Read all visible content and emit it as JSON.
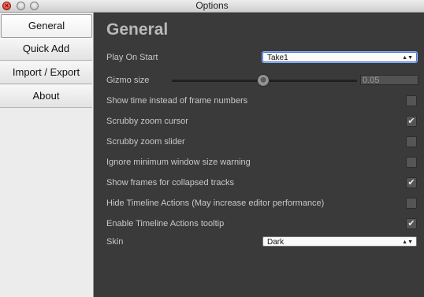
{
  "window": {
    "title": "Options"
  },
  "sidebar": {
    "items": [
      {
        "label": "General",
        "active": true
      },
      {
        "label": "Quick Add",
        "active": false
      },
      {
        "label": "Import / Export",
        "active": false
      },
      {
        "label": "About",
        "active": false
      }
    ]
  },
  "main": {
    "heading": "General",
    "play_on_start": {
      "label": "Play On Start",
      "value": "Take1"
    },
    "gizmo_size": {
      "label": "Gizmo size",
      "value": "0.05"
    },
    "options": [
      {
        "label": "Show time instead of frame numbers",
        "checked": false
      },
      {
        "label": "Scrubby zoom cursor",
        "checked": true
      },
      {
        "label": "Scrubby zoom slider",
        "checked": false
      },
      {
        "label": "Ignore minimum window size warning",
        "checked": false
      },
      {
        "label": "Show frames for collapsed tracks",
        "checked": true
      },
      {
        "label": "Hide Timeline Actions (May increase editor performance)",
        "checked": false
      },
      {
        "label": "Enable Timeline Actions tooltip",
        "checked": true
      }
    ],
    "skin": {
      "label": "Skin",
      "value": "Dark"
    },
    "check_glyph": "✔",
    "dropdown_arrow_glyph": "▲▼"
  },
  "colors": {
    "panel_bg": "#3a3a3a",
    "sidebar_bg": "#ececec",
    "text": "#c8c8c8",
    "focus": "#4a78d8"
  }
}
